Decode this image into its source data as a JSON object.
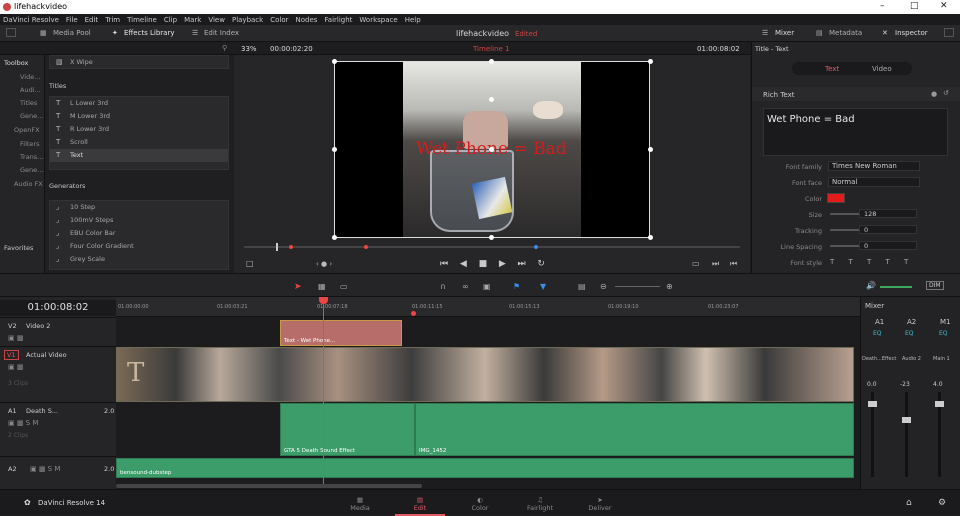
{
  "window": {
    "title": "lifehackvideo"
  },
  "menu": [
    "DaVinci Resolve",
    "File",
    "Edit",
    "Trim",
    "Timeline",
    "Clip",
    "Mark",
    "View",
    "Playback",
    "Color",
    "Nodes",
    "Fairlight",
    "Workspace",
    "Help"
  ],
  "toolbar": {
    "media_pool": "Media Pool",
    "effects_library": "Effects Library",
    "edit_index": "Edit Index",
    "project_name": "lifehackvideo",
    "project_state": "Edited",
    "mixer": "Mixer",
    "metadata": "Metadata",
    "inspector": "Inspector"
  },
  "viewer_bar": {
    "zoom": "33%",
    "timecode_left": "00:00:02:20",
    "timeline_name": "Timeline 1",
    "timecode_right": "01:00:08:02"
  },
  "left_nav": {
    "toolbox": "Toolbox",
    "items": [
      "Vide...",
      "Audi...",
      "Titles",
      "Gene..."
    ],
    "openfx": "OpenFX",
    "openfx_items": [
      "Filters",
      "Trans...",
      "Gene..."
    ],
    "audiofx": "Audio FX",
    "favorites": "Favorites"
  },
  "effects": {
    "partial_item": "X Wipe",
    "titles_header": "Titles",
    "titles": [
      "L Lower 3rd",
      "M Lower 3rd",
      "R Lower 3rd",
      "Scroll",
      "Text"
    ],
    "generators_header": "Generators",
    "generators": [
      "10 Step",
      "100mV Steps",
      "EBU Color Bar",
      "Four Color Gradient",
      "Grey Scale"
    ]
  },
  "viewer": {
    "overlay_text": "Wet Phone = Bad",
    "overlay_color": "#d51c1c"
  },
  "inspector": {
    "title": "Title - Text",
    "tab_text": "Text",
    "tab_video": "Video",
    "section": "Rich Text",
    "text_value": "Wet Phone = Bad",
    "font_family_label": "Font family",
    "font_family_value": "Times New Roman",
    "font_face_label": "Font face",
    "font_face_value": "Normal",
    "color_label": "Color",
    "size_label": "Size",
    "size_value": "128",
    "tracking_label": "Tracking",
    "tracking_value": "0",
    "line_spacing_label": "Line Spacing",
    "line_spacing_value": "0",
    "font_style_label": "Font style"
  },
  "timeline": {
    "timecode": "01:00:08:02",
    "ruler": [
      "01:00:00:00",
      "01:00:03:21",
      "01:00:07:18",
      "01:00:11:15",
      "01:00:15:13",
      "01:00:19:10",
      "01:00:23:07"
    ],
    "tracks": {
      "v2": {
        "id": "V2",
        "name": "Video 2"
      },
      "v1": {
        "id": "V1",
        "name": "Actual Video",
        "clips": "3 Clips"
      },
      "a1": {
        "id": "A1",
        "name": "Death S...",
        "level": "2.0",
        "clips": "2 Clips"
      },
      "a2": {
        "id": "A2",
        "name": "",
        "level": "2.0"
      }
    },
    "clips": {
      "title_clip": "Text - Wet Phone...",
      "audio_1": "GTA 5 Death Sound Effect",
      "audio_2": "IMG_1452",
      "audio_3": "bensound-dubstep"
    }
  },
  "mixer": {
    "title": "Mixer",
    "channels": [
      "A1",
      "A2",
      "M1"
    ],
    "names": [
      "Death...Effect",
      "Audio 2",
      "Main 1"
    ],
    "levels": [
      "0.0",
      "-23",
      "4.0"
    ]
  },
  "pages": [
    "Media",
    "Edit",
    "Color",
    "Fairlight",
    "Deliver"
  ],
  "app_name": "DaVinci Resolve 14"
}
